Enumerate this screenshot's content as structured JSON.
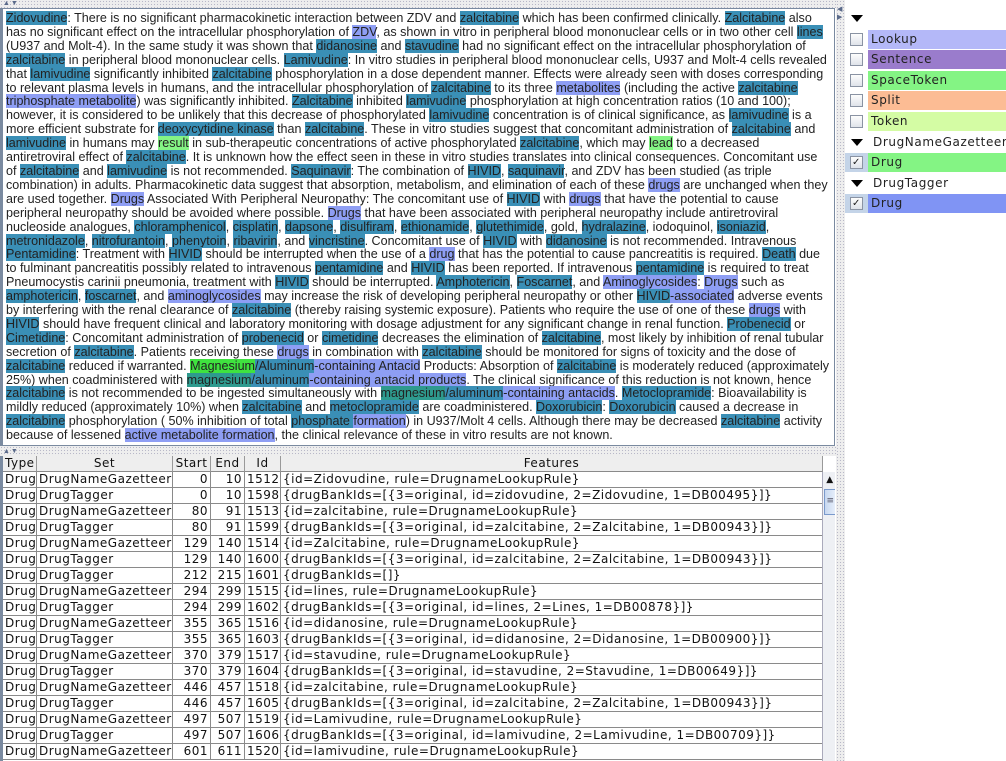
{
  "document": {
    "segments": [
      [
        "Zidovudine",
        "b"
      ],
      [
        ": There is no significant pharmacokinetic interaction between ZDV and ",
        ""
      ],
      [
        "zalcitabine",
        "b"
      ],
      [
        " which has been confirmed clinically. ",
        ""
      ],
      [
        "Zalcitabine",
        "b"
      ],
      [
        " also has no significant effect on the intracellular phosphorylation of ",
        ""
      ],
      [
        "ZDV",
        "t"
      ],
      [
        ", as shown in vitro in peripheral blood mononuclear cells or in two other cell ",
        ""
      ],
      [
        "lines",
        "b"
      ],
      [
        " (U937 and Molt-4). In the same study it was shown that ",
        ""
      ],
      [
        "didanosine",
        "b"
      ],
      [
        " and ",
        ""
      ],
      [
        "stavudine",
        "b"
      ],
      [
        " had no significant effect on the intracellular phosphorylation of ",
        ""
      ],
      [
        "zalcitabine",
        "b"
      ],
      [
        " in peripheral blood mononuclear cells. ",
        ""
      ],
      [
        "Lamivudine",
        "b"
      ],
      [
        ": In vitro studies in peripheral blood mononuclear cells, U937 and Molt-4 cells revealed that ",
        ""
      ],
      [
        "lamivudine",
        "b"
      ],
      [
        " significantly inhibited ",
        ""
      ],
      [
        "zalcitabine",
        "b"
      ],
      [
        " phosphorylation in a dose dependent manner. Effects were already seen with doses corresponding to relevant plasma levels in humans, and the intracellular phosphorylation of ",
        ""
      ],
      [
        "zalcitabine",
        "b"
      ],
      [
        " to its three ",
        ""
      ],
      [
        "metabolites",
        "t"
      ],
      [
        " (including the active ",
        ""
      ],
      [
        "zalcitabine",
        "b"
      ],
      [
        " ",
        ""
      ],
      [
        "triphosphate metabolite",
        "t"
      ],
      [
        ") was significantly inhibited. ",
        ""
      ],
      [
        "Zalcitabine",
        "b"
      ],
      [
        " inhibited ",
        ""
      ],
      [
        "lamivudine",
        "b"
      ],
      [
        " phosphorylation at high concentration ratios (10 and 100); however, it is considered to be unlikely that this decrease of phosphorylated ",
        ""
      ],
      [
        "lamivudine",
        "b"
      ],
      [
        " concentration is of clinical significance, as ",
        ""
      ],
      [
        "lamivudine",
        "b"
      ],
      [
        " is a more efficient substrate for ",
        ""
      ],
      [
        "deoxycytidine kinase",
        "b"
      ],
      [
        " than ",
        ""
      ],
      [
        "zalcitabine",
        "b"
      ],
      [
        ". These in vitro studies suggest that concomitant administration of ",
        ""
      ],
      [
        "zalcitabine",
        "b"
      ],
      [
        " and ",
        ""
      ],
      [
        "lamivudine",
        "b"
      ],
      [
        " in humans may ",
        ""
      ],
      [
        "result",
        "g"
      ],
      [
        " in sub-therapeutic concentrations of active phosphorylated ",
        ""
      ],
      [
        "zalcitabine",
        "b"
      ],
      [
        ", which may ",
        ""
      ],
      [
        "lead",
        "g"
      ],
      [
        " to a decreased antiretroviral effect of ",
        ""
      ],
      [
        "zalcitabine",
        "b"
      ],
      [
        ". It is unknown how the effect seen in these in vitro studies translates into clinical consequences. Concomitant use of ",
        ""
      ],
      [
        "zalcitabine",
        "b"
      ],
      [
        " and ",
        ""
      ],
      [
        "lamivudine",
        "b"
      ],
      [
        " is not recommended. ",
        ""
      ],
      [
        "Saquinavir",
        "b"
      ],
      [
        ": The combination of ",
        ""
      ],
      [
        "HIVID",
        "b"
      ],
      [
        ", ",
        ""
      ],
      [
        "saquinavir",
        "b"
      ],
      [
        ", and ZDV has been studied (as triple combination) in adults. Pharmacokinetic data suggest that absorption, metabolism, and elimination of each of these ",
        ""
      ],
      [
        "drugs",
        "t"
      ],
      [
        " are unchanged when they are used together. ",
        ""
      ],
      [
        "Drugs",
        "t"
      ],
      [
        " Associated With Peripheral Neuropathy: The concomitant use of ",
        ""
      ],
      [
        "HIVID",
        "b"
      ],
      [
        " with ",
        ""
      ],
      [
        "drugs",
        "t"
      ],
      [
        " that have the potential to cause peripheral neuropathy should be avoided where possible. ",
        ""
      ],
      [
        "Drugs",
        "t"
      ],
      [
        " that have been associated with peripheral neuropathy include antiretroviral nucleoside analogues, ",
        ""
      ],
      [
        "chloramphenicol",
        "b"
      ],
      [
        ", ",
        ""
      ],
      [
        "cisplatin",
        "b"
      ],
      [
        ", ",
        ""
      ],
      [
        "dapsone",
        "b"
      ],
      [
        ", ",
        ""
      ],
      [
        "disulfiram",
        "b"
      ],
      [
        ", ",
        ""
      ],
      [
        "ethionamide",
        "b"
      ],
      [
        ", ",
        ""
      ],
      [
        "glutethimide",
        "b"
      ],
      [
        ", gold, ",
        ""
      ],
      [
        "hydralazine",
        "b"
      ],
      [
        ", iodoquinol, ",
        ""
      ],
      [
        "isoniazid",
        "b"
      ],
      [
        ", ",
        ""
      ],
      [
        "metronidazole",
        "b"
      ],
      [
        ", ",
        ""
      ],
      [
        "nitrofurantoin",
        "b"
      ],
      [
        ", ",
        ""
      ],
      [
        "phenytoin",
        "b"
      ],
      [
        ", ",
        ""
      ],
      [
        "ribavirin",
        "b"
      ],
      [
        ", and ",
        ""
      ],
      [
        "vincristine",
        "b"
      ],
      [
        ". Concomitant use of ",
        ""
      ],
      [
        "HIVID",
        "b"
      ],
      [
        " with ",
        ""
      ],
      [
        "didanosine",
        "b"
      ],
      [
        " is not recommended. Intravenous ",
        ""
      ],
      [
        "Pentamidine",
        "b"
      ],
      [
        ": Treatment with ",
        ""
      ],
      [
        "HIVID",
        "b"
      ],
      [
        " should be interrupted when the use of a ",
        ""
      ],
      [
        "drug",
        "t"
      ],
      [
        " that has the potential to cause pancreatitis is required. ",
        ""
      ],
      [
        "Death",
        "b"
      ],
      [
        " due to fulminant pancreatitis possibly related to intravenous ",
        ""
      ],
      [
        "pentamidine",
        "b"
      ],
      [
        " and ",
        ""
      ],
      [
        "HIVID",
        "b"
      ],
      [
        " has been reported. If intravenous ",
        ""
      ],
      [
        "pentamidine",
        "b"
      ],
      [
        " is required to treat Pneumocystis carinii pneumonia, treatment with ",
        ""
      ],
      [
        "HIVID",
        "b"
      ],
      [
        " should be interrupted. ",
        ""
      ],
      [
        "Amphotericin",
        "b"
      ],
      [
        ", ",
        ""
      ],
      [
        "Foscarnet",
        "b"
      ],
      [
        ", and ",
        ""
      ],
      [
        "Aminoglycosides",
        "t"
      ],
      [
        ": ",
        ""
      ],
      [
        "Drugs",
        "t"
      ],
      [
        " such as ",
        ""
      ],
      [
        "amphotericin",
        "b"
      ],
      [
        ", ",
        ""
      ],
      [
        "foscarnet",
        "b"
      ],
      [
        ", and ",
        ""
      ],
      [
        "aminoglycosides",
        "t"
      ],
      [
        " may increase the risk of developing peripheral neuropathy or other ",
        ""
      ],
      [
        "HIVID",
        "b"
      ],
      [
        "-associated",
        "t"
      ],
      [
        " adverse events by interfering with the renal clearance of ",
        ""
      ],
      [
        "zalcitabine",
        "b"
      ],
      [
        " (thereby raising systemic exposure). Patients who require the use of one of these ",
        ""
      ],
      [
        "drugs",
        "t"
      ],
      [
        " with ",
        ""
      ],
      [
        "HIVID",
        "b"
      ],
      [
        " should have frequent clinical and laboratory monitoring with dosage adjustment for any significant change in renal function. ",
        ""
      ],
      [
        "Probenecid",
        "b"
      ],
      [
        " or ",
        ""
      ],
      [
        "Cimetidine",
        "b"
      ],
      [
        ": Concomitant administration of ",
        ""
      ],
      [
        "probenecid",
        "b"
      ],
      [
        " or ",
        ""
      ],
      [
        "cimetidine",
        "b"
      ],
      [
        " decreases the elimination of ",
        ""
      ],
      [
        "zalcitabine",
        "b"
      ],
      [
        ", most likely by inhibition of renal tubular secretion of ",
        ""
      ],
      [
        "zalcitabine",
        "b"
      ],
      [
        ". Patients receiving these ",
        ""
      ],
      [
        "drugs",
        "t"
      ],
      [
        " in combination with ",
        ""
      ],
      [
        "zalcitabine",
        "b"
      ],
      [
        " should be monitored for signs of toxicity and the dose of ",
        ""
      ],
      [
        "zalcitabine",
        "b"
      ],
      [
        " reduced if warranted. ",
        ""
      ],
      [
        "Magnesium",
        "G"
      ],
      [
        "/Aluminum",
        "b"
      ],
      [
        "-containing Antacid",
        "t"
      ],
      [
        " Products: Absorption of ",
        ""
      ],
      [
        "zalcitabine",
        "b"
      ],
      [
        " is moderately reduced (approximately 25%) when coadministered with ",
        ""
      ],
      [
        "magnesium",
        "m"
      ],
      [
        "/aluminum",
        "b"
      ],
      [
        "-containing antacid products",
        "t"
      ],
      [
        ". The clinical significance of this reduction is not known, hence ",
        ""
      ],
      [
        "zalcitabine",
        "b"
      ],
      [
        " is not recommended to be ingested simultaneously with ",
        ""
      ],
      [
        "magnesium",
        "m"
      ],
      [
        "/aluminum",
        "b"
      ],
      [
        "-containing antacids",
        "t"
      ],
      [
        ". ",
        ""
      ],
      [
        "Metoclopramide",
        "b"
      ],
      [
        ": Bioavailability is mildly reduced (approximately 10%) when ",
        ""
      ],
      [
        "zalcitabine",
        "b"
      ],
      [
        " and ",
        ""
      ],
      [
        "metoclopramide",
        "b"
      ],
      [
        " are coadministered. ",
        ""
      ],
      [
        "Doxorubicin",
        "b"
      ],
      [
        ": ",
        ""
      ],
      [
        "Doxorubicin",
        "b"
      ],
      [
        " caused a decrease in ",
        ""
      ],
      [
        "zalcitabine",
        "b"
      ],
      [
        " phosphorylation ( 50% inhibition of total ",
        ""
      ],
      [
        "phosphate ",
        "b"
      ],
      [
        "formation",
        "t"
      ],
      [
        ") in U937/Molt 4 cells. Although there may be decreased ",
        ""
      ],
      [
        "zalcitabine",
        "b"
      ],
      [
        " activity because of lessened ",
        ""
      ],
      [
        "active metabolite formation",
        "t"
      ],
      [
        ", the clinical relevance of these in vitro results are not known.",
        ""
      ]
    ]
  },
  "annotation_sets": {
    "items": [
      {
        "kind": "group",
        "label": ""
      },
      {
        "kind": "type",
        "label": "Lookup",
        "checked": false,
        "color": "#b4b8f8"
      },
      {
        "kind": "type",
        "label": "Sentence",
        "checked": false,
        "color": "#9a7ccc"
      },
      {
        "kind": "type",
        "label": "SpaceToken",
        "checked": false,
        "color": "#84f484"
      },
      {
        "kind": "type",
        "label": "Split",
        "checked": false,
        "color": "#fcbc94"
      },
      {
        "kind": "type",
        "label": "Token",
        "checked": false,
        "color": "#d4fca4"
      },
      {
        "kind": "group",
        "label": "DrugNameGazetteer"
      },
      {
        "kind": "type",
        "label": "Drug",
        "checked": true,
        "color": "#84f484"
      },
      {
        "kind": "group",
        "label": "DrugTagger"
      },
      {
        "kind": "type",
        "label": "Drug",
        "checked": true,
        "color": "#8094f4"
      }
    ]
  },
  "table": {
    "headers": [
      "Type",
      "Set",
      "Start",
      "End",
      "Id",
      "Features"
    ],
    "rows": [
      [
        "Drug",
        "DrugNameGazetteer",
        "0",
        "10",
        "1512",
        "{id=Zidovudine, rule=DrugnameLookupRule}"
      ],
      [
        "Drug",
        "DrugTagger",
        "0",
        "10",
        "1598",
        "{drugBankIds=[{3=original, id=zidovudine, 2=Zidovudine, 1=DB00495}]}"
      ],
      [
        "Drug",
        "DrugNameGazetteer",
        "80",
        "91",
        "1513",
        "{id=zalcitabine, rule=DrugnameLookupRule}"
      ],
      [
        "Drug",
        "DrugTagger",
        "80",
        "91",
        "1599",
        "{drugBankIds=[{3=original, id=zalcitabine, 2=Zalcitabine, 1=DB00943}]}"
      ],
      [
        "Drug",
        "DrugNameGazetteer",
        "129",
        "140",
        "1514",
        "{id=Zalcitabine, rule=DrugnameLookupRule}"
      ],
      [
        "Drug",
        "DrugTagger",
        "129",
        "140",
        "1600",
        "{drugBankIds=[{3=original, id=zalcitabine, 2=Zalcitabine, 1=DB00943}]}"
      ],
      [
        "Drug",
        "DrugTagger",
        "212",
        "215",
        "1601",
        "{drugBankIds=[]}"
      ],
      [
        "Drug",
        "DrugNameGazetteer",
        "294",
        "299",
        "1515",
        "{id=lines, rule=DrugnameLookupRule}"
      ],
      [
        "Drug",
        "DrugTagger",
        "294",
        "299",
        "1602",
        "{drugBankIds=[{3=original, id=lines, 2=Lines, 1=DB00878}]}"
      ],
      [
        "Drug",
        "DrugNameGazetteer",
        "355",
        "365",
        "1516",
        "{id=didanosine, rule=DrugnameLookupRule}"
      ],
      [
        "Drug",
        "DrugTagger",
        "355",
        "365",
        "1603",
        "{drugBankIds=[{3=original, id=didanosine, 2=Didanosine, 1=DB00900}]}"
      ],
      [
        "Drug",
        "DrugNameGazetteer",
        "370",
        "379",
        "1517",
        "{id=stavudine, rule=DrugnameLookupRule}"
      ],
      [
        "Drug",
        "DrugTagger",
        "370",
        "379",
        "1604",
        "{drugBankIds=[{3=original, id=stavudine, 2=Stavudine, 1=DB00649}]}"
      ],
      [
        "Drug",
        "DrugNameGazetteer",
        "446",
        "457",
        "1518",
        "{id=zalcitabine, rule=DrugnameLookupRule}"
      ],
      [
        "Drug",
        "DrugTagger",
        "446",
        "457",
        "1605",
        "{drugBankIds=[{3=original, id=zalcitabine, 2=Zalcitabine, 1=DB00943}]}"
      ],
      [
        "Drug",
        "DrugNameGazetteer",
        "497",
        "507",
        "1519",
        "{id=Lamivudine, rule=DrugnameLookupRule}"
      ],
      [
        "Drug",
        "DrugTagger",
        "497",
        "507",
        "1606",
        "{drugBankIds=[{3=original, id=lamivudine, 2=Lamivudine, 1=DB00709}]}"
      ],
      [
        "Drug",
        "DrugNameGazetteer",
        "601",
        "611",
        "1520",
        "{id=lamivudine, rule=DrugnameLookupRule}"
      ]
    ]
  }
}
